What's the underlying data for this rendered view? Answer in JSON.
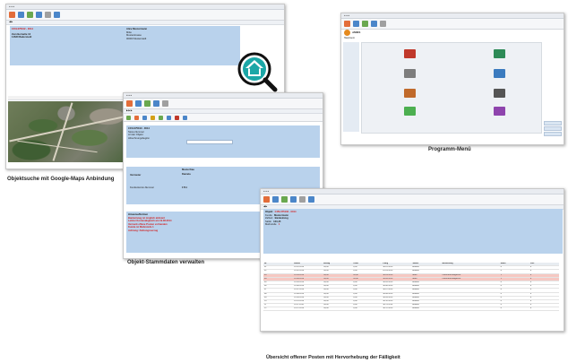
{
  "captions": {
    "map": "Objektsuche mit Google-Maps Anbindung",
    "stammdaten": "Objekt-Stammdaten verwalten",
    "menu": "Programm-Menü",
    "posten": "Übersicht offener Posten mit Hervorhebung der Fälligkeit"
  },
  "object": {
    "number": "C15L075102 - 0014",
    "address_left": [
      "Zum Bernatte 13",
      "14630 Raderstedt"
    ],
    "address_right": [
      "Alice Mustermann",
      "Mitte",
      "Musterstrasse",
      "00000 Musterstadt"
    ]
  },
  "stamm": {
    "code": "C15L075102 - 0014",
    "fields": [
      "Stoss-Nummer",
      "Art der Objekt",
      "Abrechnungsbeginn"
    ],
    "person_label": "Musterfrau",
    "person_first": "Daniela",
    "person_role": "Vermieter",
    "bank": "Kundenkonto-Nummer",
    "bank_val": "1711",
    "notes_title": "Hinweise/Notizen",
    "notes": [
      "Bankeinzug ist möglich aktiviert",
      "Letzter Kontenabgleich am 19.08.2014",
      "Vermerk offene Posten vorhanden",
      "Kunde ist Mahnstufe 1",
      "Achtung: Zahlungsverzug"
    ]
  },
  "posten": {
    "code": "C15L075102 - 0014",
    "info": [
      [
        "Objekt",
        "C15L075102 - 0014"
      ],
      [
        "Kunde",
        "Mustermann"
      ],
      [
        "Zahlart",
        "Bankeinzug"
      ],
      [
        "Saldo",
        "123,45"
      ],
      [
        "Mahnstufe",
        "1"
      ]
    ],
    "headers": [
      "Nr",
      "Datum",
      "Betrag",
      "Offen",
      "Fällig",
      "Status",
      "Bemerkung",
      "Mahn",
      "Zins"
    ],
    "rows": [
      [
        "01",
        "15.01.2014",
        "59,50",
        "0,00",
        "30.01.2014",
        "bezahlt",
        "",
        "0",
        "0"
      ],
      [
        "02",
        "15.02.2014",
        "59,50",
        "0,00",
        "02.03.2014",
        "bezahlt",
        "",
        "0",
        "0"
      ],
      [
        "03",
        "15.03.2014",
        "59,50",
        "59,50",
        "30.03.2014",
        "offen",
        "Lastschrift fehlgeschl.",
        "1",
        "0"
      ],
      [
        "04",
        "15.04.2014",
        "59,50",
        "59,50",
        "30.04.2014",
        "offen",
        "Lastschrift fehlgeschl.",
        "1",
        "0"
      ],
      [
        "05",
        "15.05.2014",
        "59,50",
        "0,00",
        "30.05.2014",
        "bezahlt",
        "",
        "0",
        "0"
      ],
      [
        "06",
        "15.06.2014",
        "59,50",
        "0,00",
        "30.06.2014",
        "bezahlt",
        "",
        "0",
        "0"
      ],
      [
        "07",
        "15.07.2014",
        "59,50",
        "0,00",
        "30.07.2014",
        "bezahlt",
        "",
        "0",
        "0"
      ],
      [
        "08",
        "15.08.2014",
        "59,50",
        "0,00",
        "30.08.2014",
        "bezahlt",
        "",
        "0",
        "0"
      ],
      [
        "09",
        "15.09.2014",
        "59,50",
        "0,00",
        "30.09.2014",
        "bezahlt",
        "",
        "0",
        "0"
      ],
      [
        "10",
        "15.10.2014",
        "59,50",
        "0,00",
        "30.10.2014",
        "bezahlt",
        "",
        "0",
        "0"
      ],
      [
        "11",
        "15.11.2014",
        "59,50",
        "0,00",
        "30.11.2014",
        "bezahlt",
        "",
        "0",
        "0"
      ],
      [
        "12",
        "15.12.2014",
        "59,50",
        "0,00",
        "30.12.2014",
        "bezahlt",
        "",
        "0",
        "0"
      ]
    ]
  },
  "menu": {
    "title": "JAMES",
    "subtitle": "Hauptmenü"
  },
  "colors": {
    "panel": "#b9d2ec",
    "accent_red": "#d21c1c",
    "row_red": "#f6c8c2",
    "logo_teal": "#1ba7a7"
  }
}
